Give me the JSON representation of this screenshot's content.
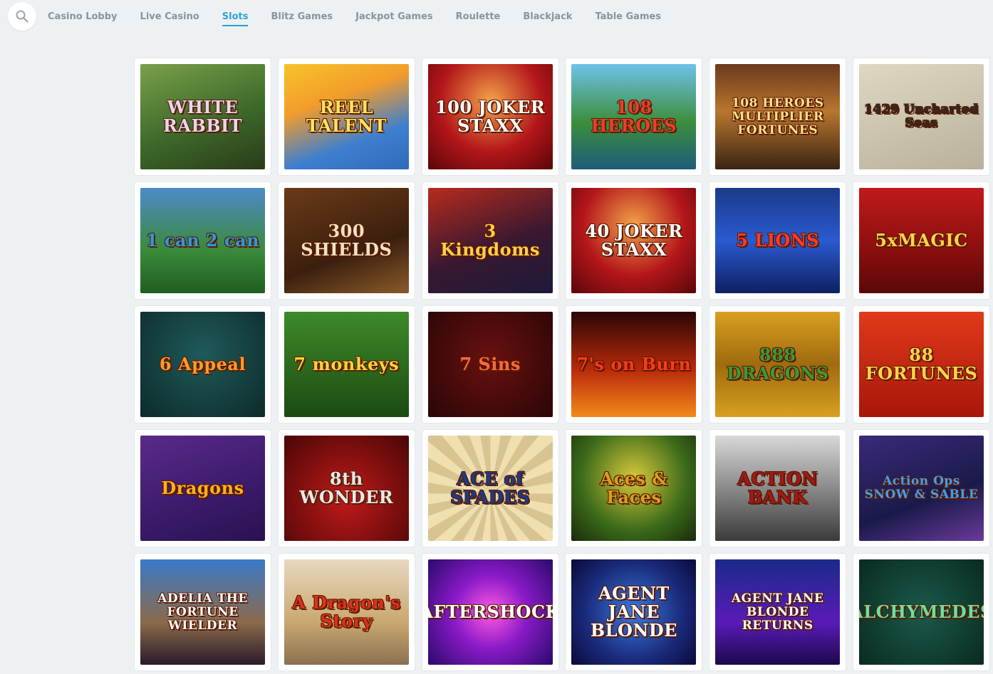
{
  "nav": {
    "items": [
      "Casino Lobby",
      "Live Casino",
      "Slots",
      "Blitz Games",
      "Jackpot Games",
      "Roulette",
      "Blackjack",
      "Table Games"
    ],
    "active": "Slots"
  },
  "games": [
    {
      "title": "WHITE RABBIT",
      "bg": "linear-gradient(160deg,#7aa04a,#3d6a2a 55%,#2a3b1a)",
      "fg": "#e8d6f0"
    },
    {
      "title": "REEL TALENT",
      "bg": "linear-gradient(160deg,#f7c32a,#f29c2b 35%,#3d7fcf 70%,#2f6bb8)",
      "fg": "#ffe45c"
    },
    {
      "title": "100 JOKER STAXX",
      "bg": "radial-gradient(circle at 50% 35%,#f3a24a,#b3161a 55%,#5a0609)",
      "fg": "#ffffff"
    },
    {
      "title": "108 HEROES",
      "bg": "linear-gradient(180deg,#6fc2e8,#3b8f3c 55%,#1f5c7a)",
      "fg": "#e8402b"
    },
    {
      "title": "108 HEROES MULTIPLIER FORTUNES",
      "bg": "linear-gradient(180deg,#6b3a1c,#b8762e 45%,#3a2413)",
      "fg": "#ffe08a"
    },
    {
      "title": "1429 Uncharted Seas",
      "bg": "linear-gradient(160deg,#ded8c2,#b9b19a)",
      "fg": "#2b2b2b"
    },
    {
      "title": "1 can 2 can",
      "bg": "linear-gradient(180deg,#4d8ac9,#3a8a3a 60%,#1f5e20)",
      "fg": "#2a9be0"
    },
    {
      "title": "300 SHIELDS",
      "bg": "linear-gradient(160deg,#6b3a18,#3b1f0e 60%,#8a5a2a)",
      "fg": "#f0e2c2"
    },
    {
      "title": "3 Kingdoms",
      "bg": "linear-gradient(160deg,#b72b1d,#3a1830 55%,#1d1a3a)",
      "fg": "#ffcf4a"
    },
    {
      "title": "40 JOKER STAXX",
      "bg": "radial-gradient(circle at 50% 35%,#f3a24a,#b3161a 55%,#5a0609)",
      "fg": "#ffffff"
    },
    {
      "title": "5 LIONS",
      "bg": "linear-gradient(180deg,#1b3a8a,#2a5ad0 50%,#0e2060)",
      "fg": "#ff3a2a"
    },
    {
      "title": "5xMAGIC",
      "bg": "linear-gradient(180deg,#c01a1a,#8a0e0e 60%,#5a0808)",
      "fg": "#ffd24a"
    },
    {
      "title": "6 Appeal",
      "bg": "radial-gradient(circle at 50% 40%,#1f5a5a,#0e2a2a)",
      "fg": "#ff9a2a"
    },
    {
      "title": "7 monkeys",
      "bg": "linear-gradient(180deg,#3d8a2a,#1c4a12)",
      "fg": "#ffd23a"
    },
    {
      "title": "7 Sins",
      "bg": "radial-gradient(circle at 50% 45%,#6a1010,#2a0606)",
      "fg": "#ff6a3a"
    },
    {
      "title": "7's on Burn",
      "bg": "linear-gradient(180deg,#2a0606,#b82a0a 55%,#f28a1a)",
      "fg": "#ff3a1a"
    },
    {
      "title": "888 DRAGONS",
      "bg": "linear-gradient(180deg,#d8a020,#a06a10 50%,#d8a020)",
      "fg": "#3a9a3a"
    },
    {
      "title": "88 FORTUNES",
      "bg": "linear-gradient(180deg,#e03a1a,#a8160a)",
      "fg": "#ffd24a"
    },
    {
      "title": "Dragons",
      "bg": "linear-gradient(160deg,#5a2a8a,#3a1a6a 60%,#2a1250)",
      "fg": "#ffb21a"
    },
    {
      "title": "8th WONDER",
      "bg": "radial-gradient(circle at 50% 60%,#c01a1a,#4a0606)",
      "fg": "#e8e8e8"
    },
    {
      "title": "ACE of SPADES",
      "bg": "repeating-conic-gradient(from 0deg at 50% 55%,#f0e0b0 0deg 10deg,#d8c490 10deg 20deg)",
      "fg": "#1a3a8a"
    },
    {
      "title": "Aces & Faces",
      "bg": "radial-gradient(circle at 50% 40%,#d8c83a,#3a6a1a 60%,#1a2a0a)",
      "fg": "#d8a020"
    },
    {
      "title": "ACTION BANK",
      "bg": "linear-gradient(180deg,#d8d8d8,#8a8a8a 50%,#3a3a3a)",
      "fg": "#a01a1a"
    },
    {
      "title": "Action Ops SNOW & SABLE",
      "bg": "linear-gradient(160deg,#3a2a7a,#1a1a4a 60%,#6a3a9a)",
      "fg": "#3aa0ff"
    },
    {
      "title": "ADELIA THE FORTUNE WIELDER",
      "bg": "linear-gradient(180deg,#3a7ac8,#8a6a4a 60%,#2a1a2a)",
      "fg": "#ffffff"
    },
    {
      "title": "A Dragon's Story",
      "bg": "linear-gradient(180deg,#e8d8c0,#c8a870 60%,#8a7050)",
      "fg": "#e0301a"
    },
    {
      "title": "AFTERSHOCK",
      "bg": "radial-gradient(circle at 50% 50%,#ff5ae0,#8a1ac8 45%,#2a0a6a)",
      "fg": "#ffffff"
    },
    {
      "title": "AGENT JANE BLONDE",
      "bg": "radial-gradient(circle at 50% 50%,#3a7ae0,#1a2a7a 60%,#0a0a3a)",
      "fg": "#ffffff"
    },
    {
      "title": "AGENT JANE BLONDE RETURNS",
      "bg": "linear-gradient(180deg,#1a2a8a,#5a1ab8 60%,#1a0a4a)",
      "fg": "#ffffff"
    },
    {
      "title": "ALCHYMEDES",
      "bg": "radial-gradient(circle at 50% 50%,#1a5a4a,#0a2a22)",
      "fg": "#6ae0a0"
    }
  ]
}
